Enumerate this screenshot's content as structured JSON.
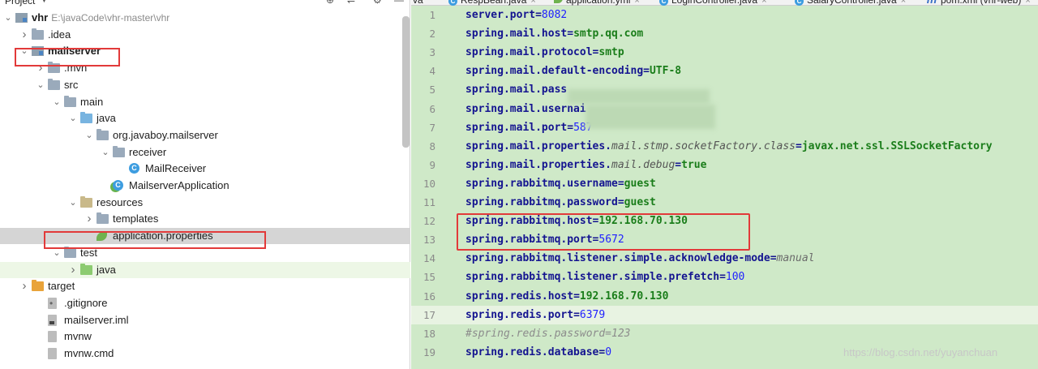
{
  "project_panel": {
    "title": "Project",
    "header_icons": [
      "globe-icon",
      "settings-split-icon",
      "gear-icon",
      "minimize-icon"
    ],
    "tree": [
      {
        "indent": 0,
        "chevron": "down",
        "icon": "module",
        "label": "vhr",
        "path": "E:\\javaCode\\vhr-master\\vhr",
        "bold": true
      },
      {
        "indent": 1,
        "chevron": "right",
        "icon": "folder",
        "label": ".idea"
      },
      {
        "indent": 1,
        "chevron": "down",
        "icon": "module",
        "label": "mailserver",
        "bold": true,
        "highlight": true
      },
      {
        "indent": 2,
        "chevron": "right",
        "icon": "folder",
        "label": ".mvn"
      },
      {
        "indent": 2,
        "chevron": "down",
        "icon": "folder",
        "label": "src"
      },
      {
        "indent": 3,
        "chevron": "down",
        "icon": "folder",
        "label": "main"
      },
      {
        "indent": 4,
        "chevron": "down",
        "icon": "folder-blue",
        "label": "java"
      },
      {
        "indent": 5,
        "chevron": "down",
        "icon": "folder",
        "label": "org.javaboy.mailserver"
      },
      {
        "indent": 6,
        "chevron": "down",
        "icon": "folder",
        "label": "receiver"
      },
      {
        "indent": 7,
        "chevron": "",
        "icon": "class",
        "label": "MailReceiver"
      },
      {
        "indent": 6,
        "chevron": "",
        "icon": "springapp",
        "label": "MailserverApplication"
      },
      {
        "indent": 4,
        "chevron": "down",
        "icon": "folder-res",
        "label": "resources"
      },
      {
        "indent": 5,
        "chevron": "right",
        "icon": "folder",
        "label": "templates"
      },
      {
        "indent": 5,
        "chevron": "",
        "icon": "leaf",
        "label": "application.properties",
        "selected": true,
        "highlight": true
      },
      {
        "indent": 3,
        "chevron": "down",
        "icon": "folder",
        "label": "test"
      },
      {
        "indent": 4,
        "chevron": "right",
        "icon": "folder-green",
        "label": "java",
        "light": true
      },
      {
        "indent": 1,
        "chevron": "right",
        "icon": "folder-orange",
        "label": "target"
      },
      {
        "indent": 2,
        "chevron": "",
        "icon": "file git",
        "label": ".gitignore"
      },
      {
        "indent": 2,
        "chevron": "",
        "icon": "file dark",
        "label": "mailserver.iml"
      },
      {
        "indent": 2,
        "chevron": "",
        "icon": "file",
        "label": "mvnw"
      },
      {
        "indent": 2,
        "chevron": "",
        "icon": "file",
        "label": "mvnw.cmd"
      }
    ]
  },
  "tabs": [
    {
      "label": "va",
      "icon": ""
    },
    {
      "label": "RespBean.java",
      "icon": "class"
    },
    {
      "label": "application.yml",
      "icon": "leaf"
    },
    {
      "label": "LoginController.java",
      "icon": "class"
    },
    {
      "label": "SalaryController.java",
      "icon": "class"
    },
    {
      "label": "pom.xml (vhr-web)",
      "icon": "m"
    }
  ],
  "editor": {
    "current_line": 17,
    "lines": [
      {
        "n": "1",
        "key": "server.port",
        "val": "8082",
        "type": "num"
      },
      {
        "n": "2",
        "key": "spring.mail.host",
        "val": "smtp.qq.com",
        "type": "str"
      },
      {
        "n": "3",
        "key": "spring.mail.protocol",
        "val": "smtp",
        "type": "str"
      },
      {
        "n": "4",
        "key": "spring.mail.default-encoding",
        "val": "UTF-8",
        "type": "str"
      },
      {
        "n": "5",
        "key": "spring.mail.pass",
        "val": "",
        "type": "blurred"
      },
      {
        "n": "6",
        "key": "spring.mail.usernai",
        "val": "",
        "type": "blurred"
      },
      {
        "n": "7",
        "key": "spring.mail.port",
        "val": "587",
        "type": "num"
      },
      {
        "n": "8",
        "key": "spring.mail.properties.",
        "italic": "mail.stmp.socketFactory.class",
        "val": "javax.net.ssl.SSLSocketFactory",
        "type": "str-italic"
      },
      {
        "n": "9",
        "key": "spring.mail.properties.",
        "italic": "mail.debug",
        "val": "true",
        "type": "str-italic"
      },
      {
        "n": "10",
        "key": "spring.rabbitmq.username",
        "val": "guest",
        "type": "str"
      },
      {
        "n": "11",
        "key": "spring.rabbitmq.password",
        "val": "guest",
        "type": "str"
      },
      {
        "n": "12",
        "key": "spring.rabbitmq.host",
        "val": "192.168.70.130",
        "type": "str"
      },
      {
        "n": "13",
        "key": "spring.rabbitmq.port",
        "val": "5672",
        "type": "num"
      },
      {
        "n": "14",
        "key": "spring.rabbitmq.listener.simple.acknowledge-mode",
        "val": "manual",
        "type": "italic-val"
      },
      {
        "n": "15",
        "key": "spring.rabbitmq.listener.simple.prefetch",
        "val": "100",
        "type": "num"
      },
      {
        "n": "16",
        "key": "spring.redis.host",
        "val": "192.168.70.130",
        "type": "str"
      },
      {
        "n": "17",
        "key": "spring.redis.port",
        "val": "6379",
        "type": "num"
      },
      {
        "n": "18",
        "key": "",
        "val": "#spring.redis.password=123",
        "type": "comment"
      },
      {
        "n": "19",
        "key": "spring.redis.database",
        "val": "0",
        "type": "num"
      }
    ]
  },
  "watermark": "https://blog.csdn.net/yuyanchuan",
  "colors": {
    "highlight_box": "#e23a3a",
    "editor_bg": "#cfe9c8",
    "key": "#141490",
    "value": "#1a7d1a",
    "number": "#1f1fff"
  }
}
